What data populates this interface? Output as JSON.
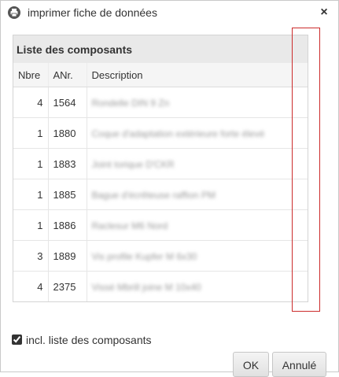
{
  "dialog": {
    "title": "imprimer fiche de données",
    "close_glyph": "×",
    "title_icon": "print-icon",
    "close_icon": "close-icon"
  },
  "panel": {
    "title": "Liste des composants",
    "columns": [
      "Nbre",
      "ANr.",
      "Description"
    ],
    "rows": [
      {
        "nbre": "4",
        "anr": "1564",
        "description": "Rondelle DIN 9 Zn"
      },
      {
        "nbre": "1",
        "anr": "1880",
        "description": "Coque d'adaptation extérieure forte élevé"
      },
      {
        "nbre": "1",
        "anr": "1883",
        "description": "Joint torique D'CKR"
      },
      {
        "nbre": "1",
        "anr": "1885",
        "description": "Bague d'écrêteuse raffion PM"
      },
      {
        "nbre": "1",
        "anr": "1886",
        "description": "Raclesur M6 Nord"
      },
      {
        "nbre": "3",
        "anr": "1889",
        "description": "Vis profile Kupfer M 6x30"
      },
      {
        "nbre": "4",
        "anr": "2375",
        "description": "Vissé Mbrill joine M 10x40"
      }
    ]
  },
  "options": {
    "include_list_label": "incl. liste des composants",
    "include_list_checked": true
  },
  "buttons": {
    "ok": "OK",
    "cancel": "Annulé"
  },
  "colors": {
    "header_bg": "#e9e9e9",
    "highlight_frame": "#cc2b2b",
    "button_bg": "#e8e8e8"
  }
}
